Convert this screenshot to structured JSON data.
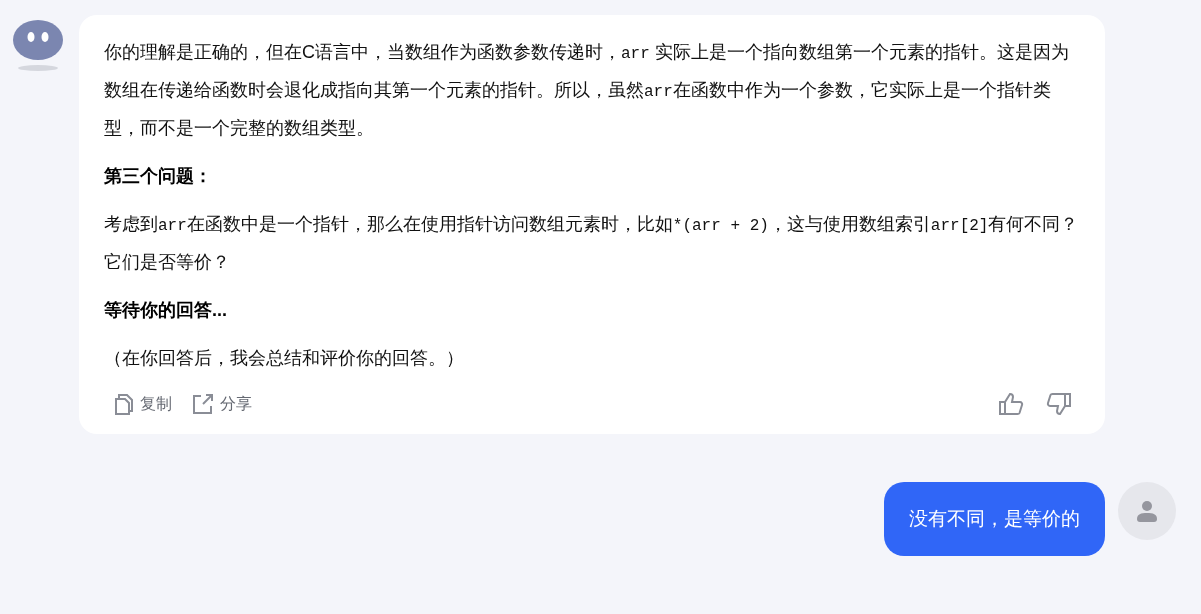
{
  "assistant_message": {
    "blocks": [
      {
        "kind": "paragraph",
        "segments": [
          {
            "kind": "text",
            "text": "你的理解是正确的，但在C语言中，当数组作为函数参数传递时，"
          },
          {
            "kind": "code",
            "text": "arr"
          },
          {
            "kind": "text",
            "text": " 实际上是一个指向数组第一个元素的指针。这是因为数组在传递给函数时会退化成指向其第一个元素的指针。所以，虽然"
          },
          {
            "kind": "code",
            "text": "arr"
          },
          {
            "kind": "text",
            "text": "在函数中作为一个参数，它实际上是一个指针类型，而不是一个完整的数组类型。"
          }
        ]
      },
      {
        "kind": "heading",
        "text": "第三个问题："
      },
      {
        "kind": "paragraph",
        "segments": [
          {
            "kind": "text",
            "text": "考虑到"
          },
          {
            "kind": "code",
            "text": "arr"
          },
          {
            "kind": "text",
            "text": "在函数中是一个指针，那么在使用指针访问数组元素时，比如"
          },
          {
            "kind": "code",
            "text": "*(arr + 2)"
          },
          {
            "kind": "text",
            "text": "，这与使用数组索引"
          },
          {
            "kind": "code",
            "text": "arr[2]"
          },
          {
            "kind": "text",
            "text": "有何不同？它们是否等价？"
          }
        ]
      },
      {
        "kind": "heading",
        "text": "等待你的回答..."
      },
      {
        "kind": "paragraph",
        "segments": [
          {
            "kind": "text",
            "text": "（在你回答后，我会总结和评价你的回答。）"
          }
        ]
      }
    ],
    "actions": [
      {
        "kind": "copy",
        "label": "复制"
      },
      {
        "kind": "share",
        "label": "分享"
      }
    ]
  },
  "user_message": {
    "text": "没有不同，是等价的"
  }
}
